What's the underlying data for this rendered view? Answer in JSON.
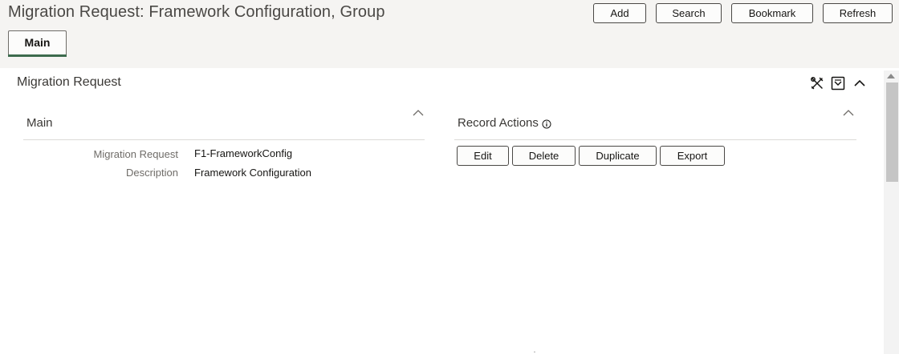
{
  "page": {
    "title": "Migration Request: Framework Configuration, Group"
  },
  "toolbar": {
    "add_label": "Add",
    "search_label": "Search",
    "bookmark_label": "Bookmark",
    "refresh_label": "Refresh"
  },
  "tabs": [
    {
      "label": "Main",
      "active": true
    }
  ],
  "panel": {
    "title": "Migration Request",
    "icons": [
      "tools-icon",
      "dropdown-menu-icon",
      "collapse-chevron-icon"
    ]
  },
  "main_section": {
    "title": "Main",
    "fields": [
      {
        "label": "Migration Request",
        "value": "F1-FrameworkConfig"
      },
      {
        "label": "Description",
        "value": "Framework Configuration"
      }
    ]
  },
  "record_actions": {
    "title": "Record Actions",
    "info_icon": "info-icon",
    "buttons": [
      "Edit",
      "Delete",
      "Duplicate",
      "Export"
    ]
  },
  "colors": {
    "topbar_bg": "#f5f4f2",
    "tab_underline": "#3d6b4d",
    "button_border": "#4a4845"
  }
}
